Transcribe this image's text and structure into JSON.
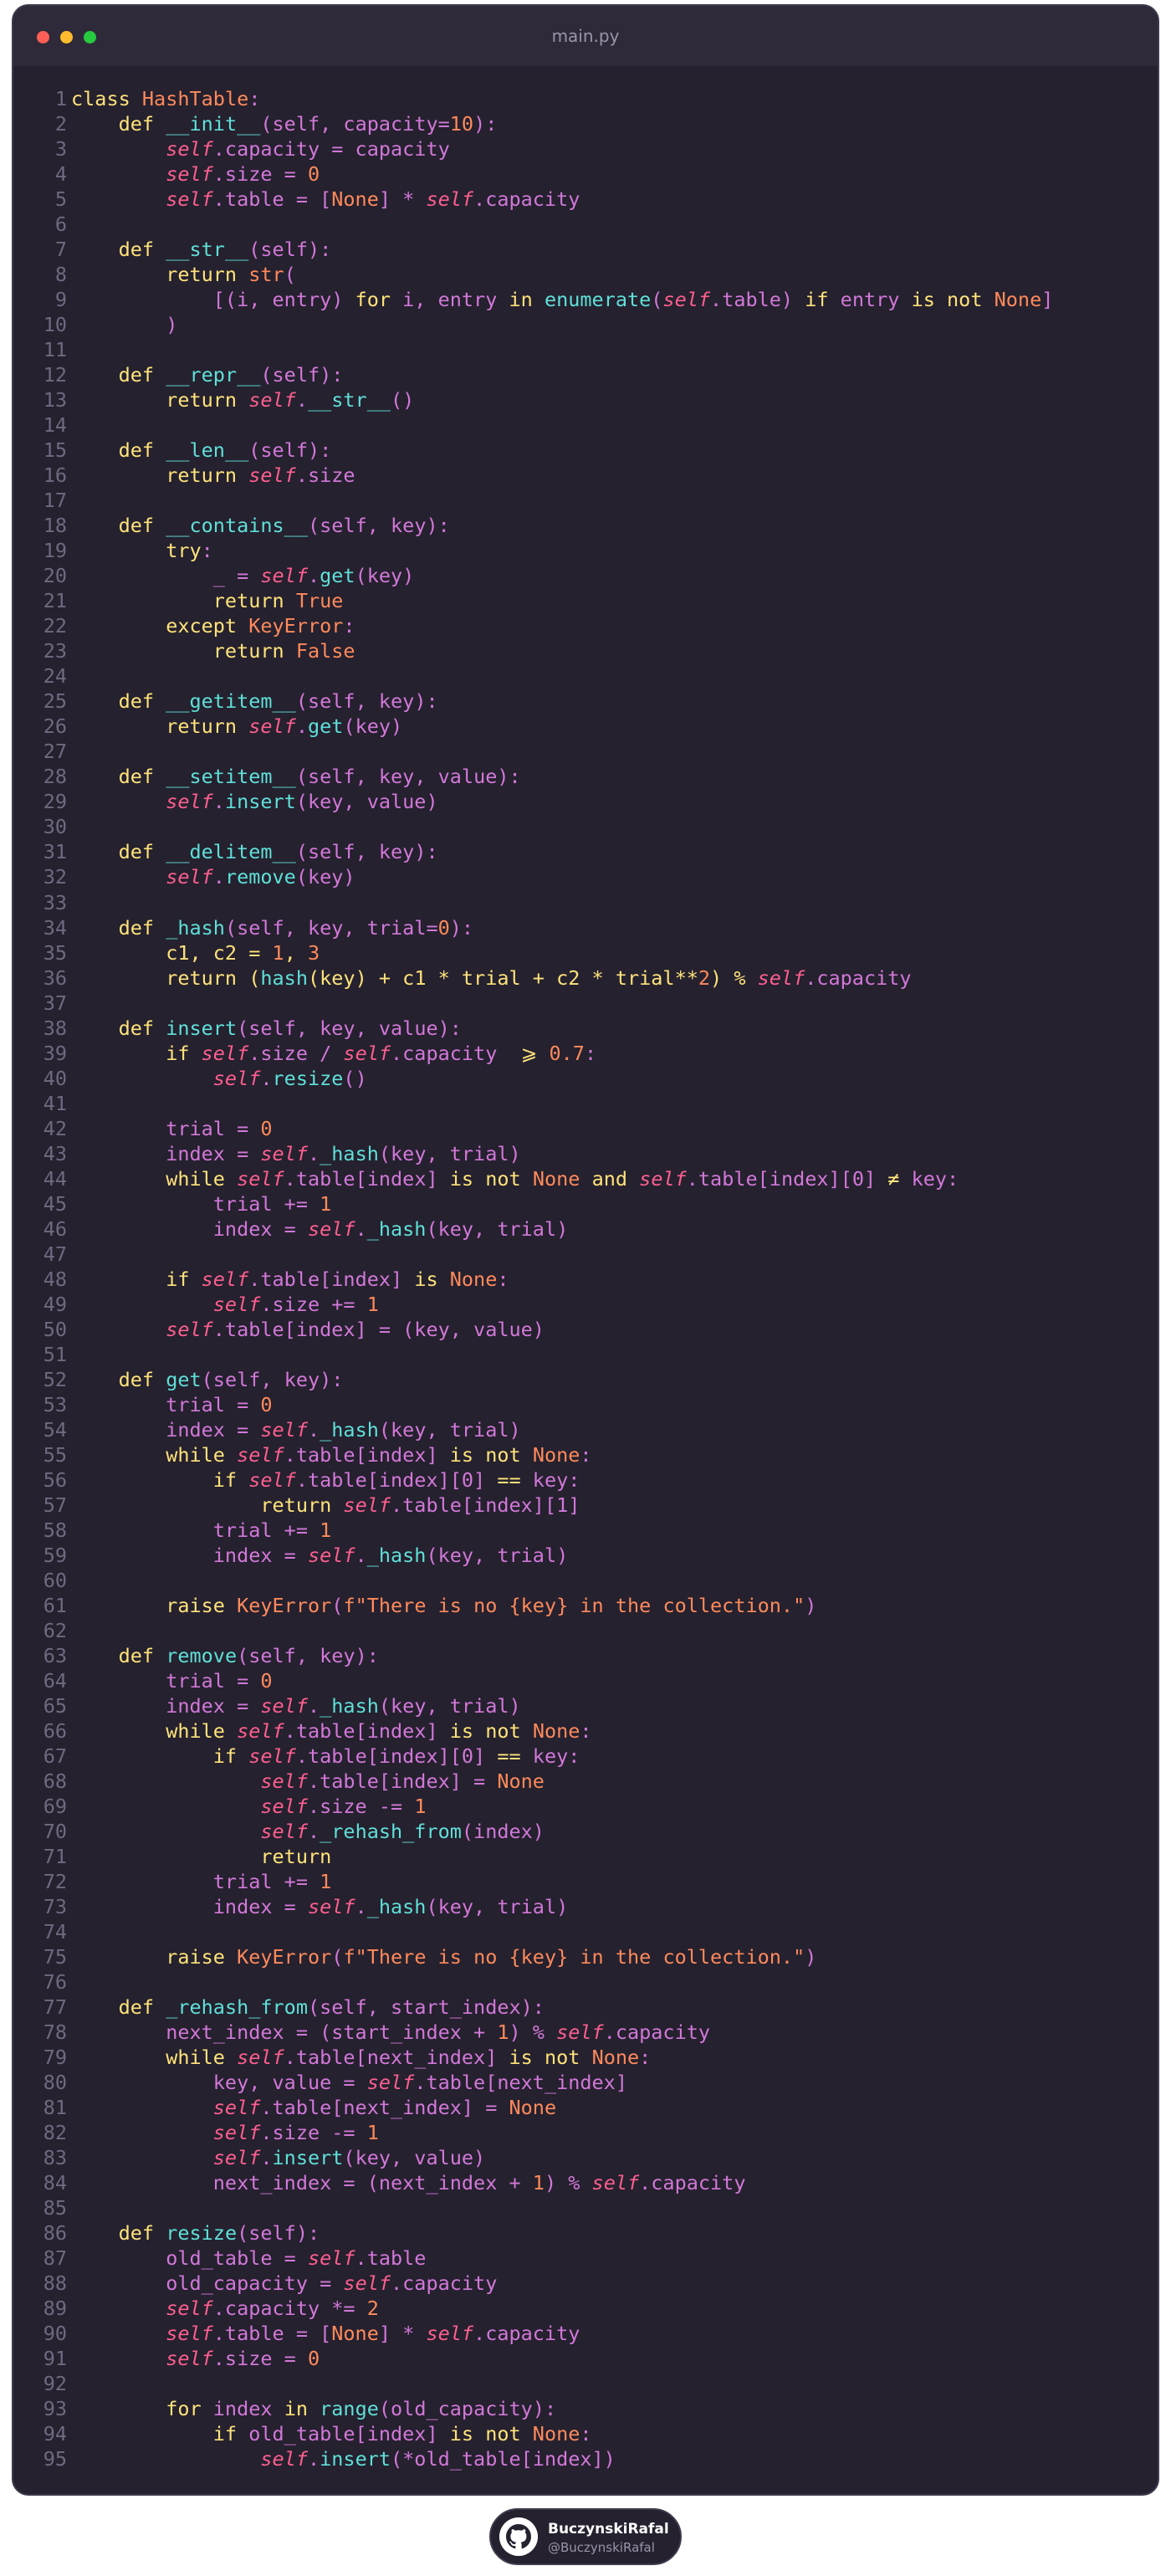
{
  "window": {
    "title": "main.py",
    "background": "#25212f",
    "titlebar_color": "#2e2a39"
  },
  "palette": {
    "K": "#ffe37a",
    "C": "#ff8a5b",
    "F": "#5fe0d8",
    "S": "#ff5f8f",
    "N": "#ff8a5b",
    "T": "#ff8a5b",
    "P": "#d278d8",
    "D": "#d8d4e6"
  },
  "code": {
    "lines": [
      "[K]class[/] [C]HashTable[/][P]:[/]",
      "    [K]def[/] [F]__init__[/][P](self, capacity=[/][N]10[/][P]):[/]",
      "        [S]self[/][P].capacity = capacity[/]",
      "        [S]self[/][P].size = [/][N]0[/]",
      "        [S]self[/][P].table = [[/][N]None[/][P]] * [/][S]self[/][P].capacity[/]",
      "",
      "    [K]def[/] [F]__str__[/][P](self):[/]",
      "        [K]return[/] [C]str[/][P]([/]",
      "            [P][(i, entry) [/][K]for[/][P] i, entry [/][K]in[/] [F]enumerate[/][P]([/][S]self[/][P].table) [/][K]if[/][P] entry [/][K]is not[/] [N]None[/][P]][/]",
      "        [P])[/]",
      "",
      "    [K]def[/] [F]__repr__[/][P](self):[/]",
      "        [K]return[/] [S]self[/][P].[/][F]__str__[/][P]()[/]",
      "",
      "    [K]def[/] [F]__len__[/][P](self):[/]",
      "        [K]return[/] [S]self[/][P].size[/]",
      "",
      "    [K]def[/] [F]__contains__[/][P](self, key):[/]",
      "        [K]try[/][P]:[/]",
      "            [P]_ = [/][S]self[/][P].[/][F]get[/][P](key)[/]",
      "            [K]return[/] [N]True[/]",
      "        [K]except[/] [C]KeyError[/][P]:[/]",
      "            [K]return[/] [N]False[/]",
      "",
      "    [K]def[/] [F]__getitem__[/][P](self, key):[/]",
      "        [K]return[/] [S]self[/][P].[/][F]get[/][P](key)[/]",
      "",
      "    [K]def[/] [F]__setitem__[/][P](self, key, value):[/]",
      "        [S]self[/][P].[/][F]insert[/][P](key, value)[/]",
      "",
      "    [K]def[/] [F]__delitem__[/][P](self, key):[/]",
      "        [S]self[/][P].[/][F]remove[/][P](key)[/]",
      "",
      "    [K]def[/] [F]_hash[/][P](self, key, trial=[/][N]0[/][P]):[/]",
      "        [K]c1, c2 = [/][N]1[/][K], [/][N]3[/]",
      "        [K]return[/] [K]([/][F]hash[/][K](key) + c1 * trial + c2 * trial**[/][N]2[/][K]) % [/][S]self[/][P].capacity[/]",
      "",
      "    [K]def[/] [F]insert[/][P](self, key, value):[/]",
      "        [K]if[/] [S]self[/][P].size / [/][S]self[/][P].capacity  [/][K]⩾[/] [N]0.7[/][P]:[/]",
      "            [S]self[/][P].[/][F]resize[/][P]()[/]",
      "",
      "        [P]trial = [/][N]0[/]",
      "        [P]index = [/][S]self[/][P].[/][F]_hash[/][P](key, trial)[/]",
      "        [K]while[/] [S]self[/][P].table[index] [/][K]is not[/] [N]None[/] [K]and[/] [S]self[/][P].table[index][0] [/][K]≠[/][P] key:[/]",
      "            [P]trial += [/][N]1[/]",
      "            [P]index = [/][S]self[/][P].[/][F]_hash[/][P](key, trial)[/]",
      "",
      "        [K]if[/] [S]self[/][P].table[index] [/][K]is[/] [N]None[/][P]:[/]",
      "            [S]self[/][P].size += [/][N]1[/]",
      "        [S]self[/][P].table[index] = (key, value)[/]",
      "",
      "    [K]def[/] [F]get[/][P](self, key):[/]",
      "        [P]trial = [/][N]0[/]",
      "        [P]index = [/][S]self[/][P].[/][F]_hash[/][P](key, trial)[/]",
      "        [K]while[/] [S]self[/][P].table[index] [/][K]is not[/] [N]None[/][P]:[/]",
      "            [K]if[/] [S]self[/][P].table[index][0] [/][K]==[/][P] key:[/]",
      "                [K]return[/] [S]self[/][P].table[index][1][/]",
      "            [P]trial += [/][N]1[/]",
      "            [P]index = [/][S]self[/][P].[/][F]_hash[/][P](key, trial)[/]",
      "",
      "        [K]raise[/] [C]KeyError[/][P]([/][T]f\"There is no {key} in the collection.\"[/][P])[/]",
      "",
      "    [K]def[/] [F]remove[/][P](self, key):[/]",
      "        [P]trial = [/][N]0[/]",
      "        [P]index = [/][S]self[/][P].[/][F]_hash[/][P](key, trial)[/]",
      "        [K]while[/] [S]self[/][P].table[index] [/][K]is not[/] [N]None[/][P]:[/]",
      "            [K]if[/] [S]self[/][P].table[index][0] [/][K]==[/][P] key:[/]",
      "                [S]self[/][P].table[index] = [/][N]None[/]",
      "                [S]self[/][P].size -= [/][N]1[/]",
      "                [S]self[/][P].[/][F]_rehash_from[/][P](index)[/]",
      "                [K]return[/]",
      "            [P]trial += [/][N]1[/]",
      "            [P]index = [/][S]self[/][P].[/][F]_hash[/][P](key, trial)[/]",
      "",
      "        [K]raise[/] [C]KeyError[/][P]([/][T]f\"There is no {key} in the collection.\"[/][P])[/]",
      "",
      "    [K]def[/] [F]_rehash_from[/][P](self, start_index):[/]",
      "        [P]next_index = (start_index + [/][N]1[/][P]) % [/][S]self[/][P].capacity[/]",
      "        [K]while[/] [S]self[/][P].table[next_index] [/][K]is not[/] [N]None[/][P]:[/]",
      "            [P]key, value = [/][S]self[/][P].table[next_index][/]",
      "            [S]self[/][P].table[next_index] = [/][N]None[/]",
      "            [S]self[/][P].size -= [/][N]1[/]",
      "            [S]self[/][P].[/][F]insert[/][P](key, value)[/]",
      "            [P]next_index = (next_index + [/][N]1[/][P]) % [/][S]self[/][P].capacity[/]",
      "",
      "    [K]def[/] [F]resize[/][P](self):[/]",
      "        [P]old_table = [/][S]self[/][P].table[/]",
      "        [P]old_capacity = [/][S]self[/][P].capacity[/]",
      "        [S]self[/][P].capacity *= [/][N]2[/]",
      "        [S]self[/][P].table = [[/][N]None[/][P]] * [/][S]self[/][P].capacity[/]",
      "        [S]self[/][P].size = [/][N]0[/]",
      "",
      "        [K]for[/][P] index [/][K]in[/] [F]range[/][P](old_capacity):[/]",
      "            [K]if[/][P] old_table[index] [/][K]is not[/] [N]None[/][P]:[/]",
      "                [S]self[/][P].[/][F]insert[/][P](*old_table[index])[/]"
    ]
  },
  "badge": {
    "name": "BuczynskiRafal",
    "handle": "@BuczynskiRafal",
    "icon": "github-icon"
  }
}
